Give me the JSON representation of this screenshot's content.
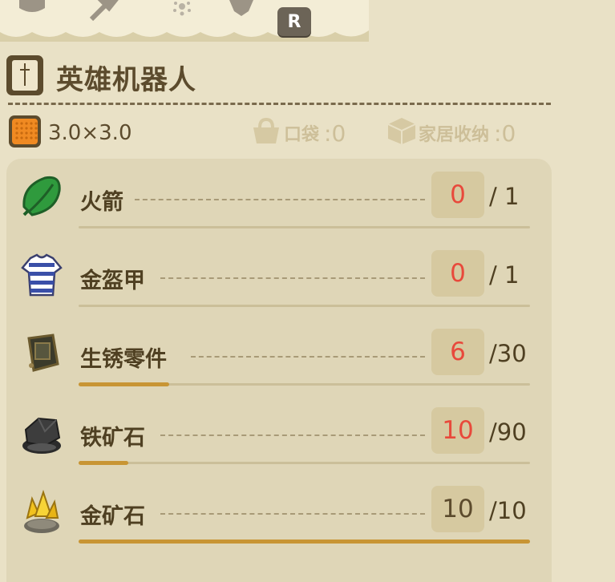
{
  "header": {
    "r_button_label": "R"
  },
  "item": {
    "name": "英雄机器人",
    "size_label": "3.0×3.0"
  },
  "storage": {
    "pocket_label": "口袋",
    "pocket_value": ":0",
    "home_label": "家居收纳",
    "home_value": ":0"
  },
  "materials": [
    {
      "name": "火箭",
      "have": "0",
      "required": "/ 1",
      "status": "low",
      "progress": 0.0,
      "icon": "leaf-icon"
    },
    {
      "name": "金盔甲",
      "have": "0",
      "required": "/ 1",
      "status": "low",
      "progress": 0.0,
      "icon": "shirt-icon"
    },
    {
      "name": "生锈零件",
      "have": "6",
      "required": "/30",
      "status": "low",
      "progress": 0.2,
      "icon": "rusted-part-icon"
    },
    {
      "name": "铁矿石",
      "have": "10",
      "required": "/90",
      "status": "low",
      "progress": 0.11,
      "icon": "iron-nugget-icon"
    },
    {
      "name": "金矿石",
      "have": "10",
      "required": "/10",
      "status": "full",
      "progress": 1.0,
      "icon": "gold-nugget-icon"
    }
  ],
  "colors": {
    "background": "#e7dfc3",
    "list_background": "#dfd6b7",
    "count_low": "#e8493b",
    "progress_fill": "#c89534",
    "text_dark": "#4f4022"
  }
}
